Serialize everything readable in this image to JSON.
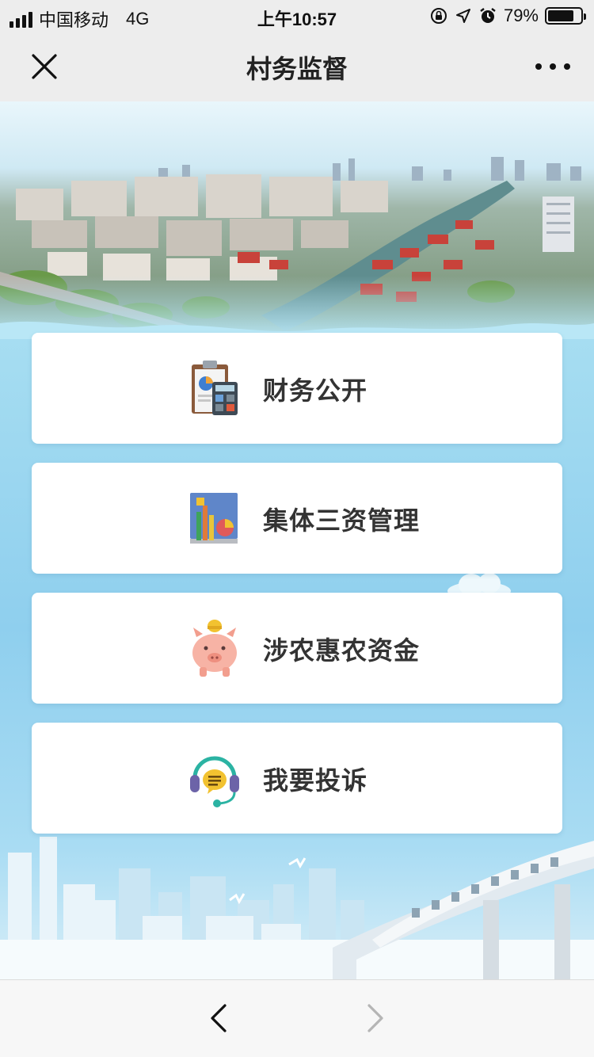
{
  "status_bar": {
    "carrier": "中国移动",
    "network": "4G",
    "time": "上午10:57",
    "battery_percent": "79%",
    "battery_level": 0.79
  },
  "nav": {
    "title": "村务监督",
    "close_icon": "close-icon",
    "more_icon": "more-icon"
  },
  "menu": [
    {
      "label": "财务公开",
      "icon": "finance-calculator-icon"
    },
    {
      "label": "集体三资管理",
      "icon": "asset-chart-icon"
    },
    {
      "label": "涉农惠农资金",
      "icon": "piggy-bank-icon"
    },
    {
      "label": "我要投诉",
      "icon": "headset-complaint-icon"
    }
  ],
  "toolbar": {
    "back_icon": "chevron-left-icon",
    "forward_icon": "chevron-right-icon"
  },
  "colors": {
    "sky": "#a4dcf1",
    "card": "#ffffff",
    "text": "#333333"
  }
}
